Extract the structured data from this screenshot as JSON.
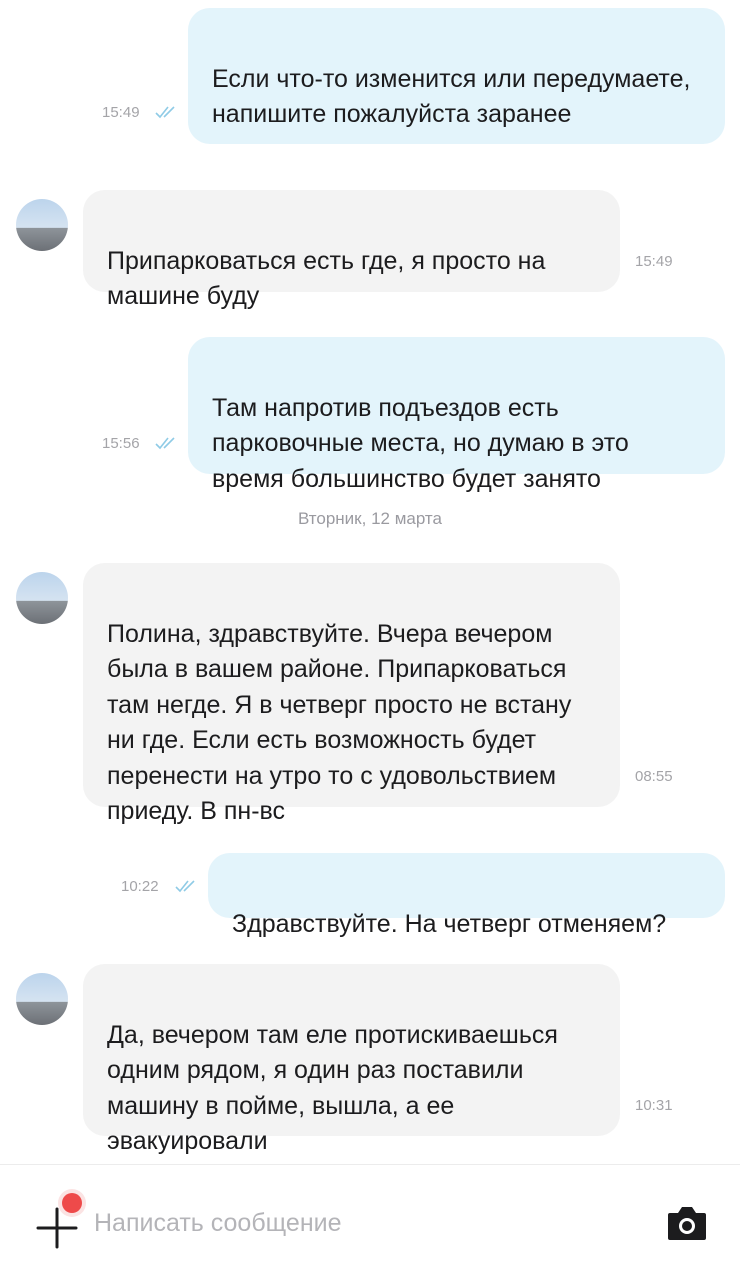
{
  "messages": [
    {
      "direction": "out",
      "text": "Если что-то изменится или передумаете, напишите пожалуйста заранее",
      "time": "15:49",
      "read": true
    },
    {
      "direction": "in",
      "text": "Припарковаться есть где, я просто на машине буду",
      "time": "15:49"
    },
    {
      "direction": "out",
      "text": "Там напротив подъездов есть парковочные места, но думаю в это время большинство будет занято",
      "time": "15:56",
      "read": true
    },
    {
      "direction": "in",
      "text": "Полина, здравствуйте. Вчера вечером была в вашем районе. Припарковаться там негде. Я в четверг просто не встану ни где. Если есть возможность будет перенести на утро то с удовольствием приеду. В пн-вс",
      "time": "08:55"
    },
    {
      "direction": "out",
      "text": "Здравствуйте. На четверг отменяем?",
      "time": "10:22",
      "read": true
    },
    {
      "direction": "in",
      "text": "Да, вечером там еле протискиваешься одним рядом, я один раз поставили машину в пойме, вышла, а ее эвакуировали",
      "time": "10:31"
    }
  ],
  "date_separator": "Вторник, 12 марта",
  "composer": {
    "placeholder": "Написать сообщение",
    "attach_icon": "plus-icon",
    "camera_icon": "camera-icon",
    "notification_dot_color": "#ee4a4a"
  },
  "colors": {
    "outgoing_bubble": "#e3f4fb",
    "incoming_bubble": "#f3f3f3",
    "read_ticks": "#8fcbe6",
    "timestamp": "#a4a4a8"
  }
}
